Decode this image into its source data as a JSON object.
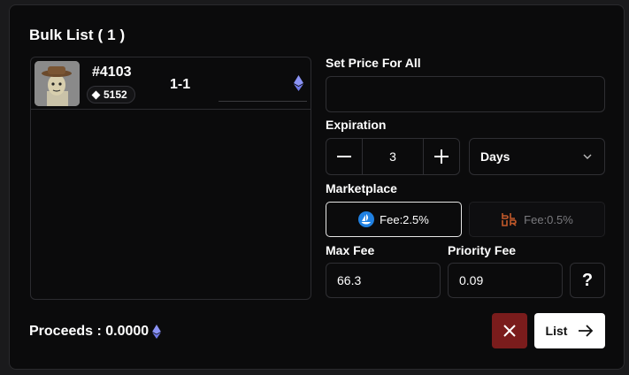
{
  "title": "Bulk List ( 1 )",
  "items": [
    {
      "token_id": "#4103",
      "rank": "5152",
      "range": "1-1",
      "price": ""
    }
  ],
  "price_for_all": {
    "label": "Set Price For All",
    "value": ""
  },
  "expiration": {
    "label": "Expiration",
    "value": "3",
    "unit": "Days"
  },
  "marketplace": {
    "label": "Marketplace",
    "options": [
      {
        "name": "OpenSea",
        "fee": "Fee:2.5%",
        "selected": true
      },
      {
        "name": "Blur",
        "fee": "Fee:0.5%",
        "selected": false
      }
    ]
  },
  "max_fee": {
    "label": "Max Fee",
    "value": "66.3"
  },
  "priority_fee": {
    "label": "Priority Fee",
    "value": "0.09"
  },
  "help": "?",
  "proceeds": "Proceeds : 0.0000",
  "actions": {
    "list_label": "List"
  },
  "colors": {
    "accent_eth": "#8b93f5",
    "cancel_bg": "#7a1c1c",
    "opensea_blue": "#2081e2",
    "blur_orange": "#c2592a"
  }
}
